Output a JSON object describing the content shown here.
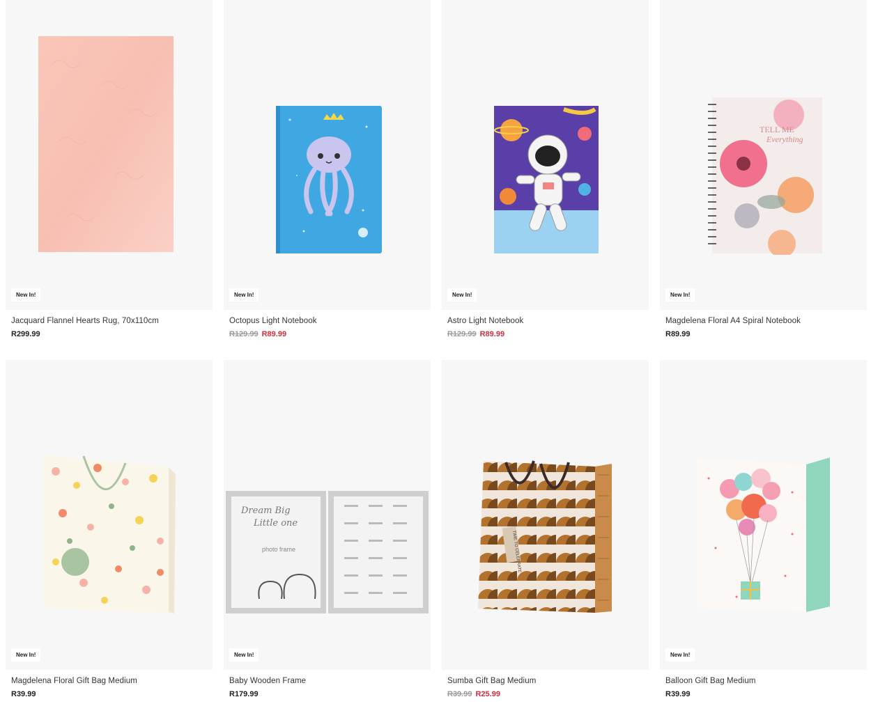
{
  "products": [
    {
      "title": "Jacquard Flannel Hearts Rug, 70x110cm",
      "badge": "New In!",
      "price": "R299.99",
      "price_old": "",
      "price_sale": "",
      "image": "pink-rug"
    },
    {
      "title": "Octopus Light Notebook",
      "badge": "New In!",
      "price": "",
      "price_old": "R129.99",
      "price_sale": "R89.99",
      "image": "octopus-notebook"
    },
    {
      "title": "Astro Light Notebook",
      "badge": "New In!",
      "price": "",
      "price_old": "R129.99",
      "price_sale": "R89.99",
      "image": "astronaut-notebook"
    },
    {
      "title": "Magdelena Floral A4 Spiral Notebook",
      "badge": "New In!",
      "price": "R89.99",
      "price_old": "",
      "price_sale": "",
      "image": "floral-spiral-notebook",
      "cover_text_1": "TELL ME",
      "cover_text_2": "Everything"
    },
    {
      "title": "Magdelena Floral Gift Bag Medium",
      "badge": "New In!",
      "price": "R39.99",
      "price_old": "",
      "price_sale": "",
      "image": "floral-gift-bag"
    },
    {
      "title": "Baby Wooden Frame",
      "badge": "New In!",
      "price": "R179.99",
      "price_old": "",
      "price_sale": "",
      "image": "baby-frame",
      "frame_text_1": "Dream Big",
      "frame_text_2": "Little one",
      "frame_text_3": "photo frame"
    },
    {
      "title": "Sumba Gift Bag Medium",
      "badge": "",
      "price": "",
      "price_old": "R39.99",
      "price_sale": "R25.99",
      "image": "sumba-gift-bag",
      "tag_text": "TIME TO CELEBRATE"
    },
    {
      "title": "Balloon Gift Bag Medium",
      "badge": "New In!",
      "price": "R39.99",
      "price_old": "",
      "price_sale": "",
      "image": "balloon-gift-bag"
    }
  ],
  "colors": {
    "sale": "#d12f3a",
    "old_price": "#999999",
    "card_bg": "#f7f7f7"
  }
}
